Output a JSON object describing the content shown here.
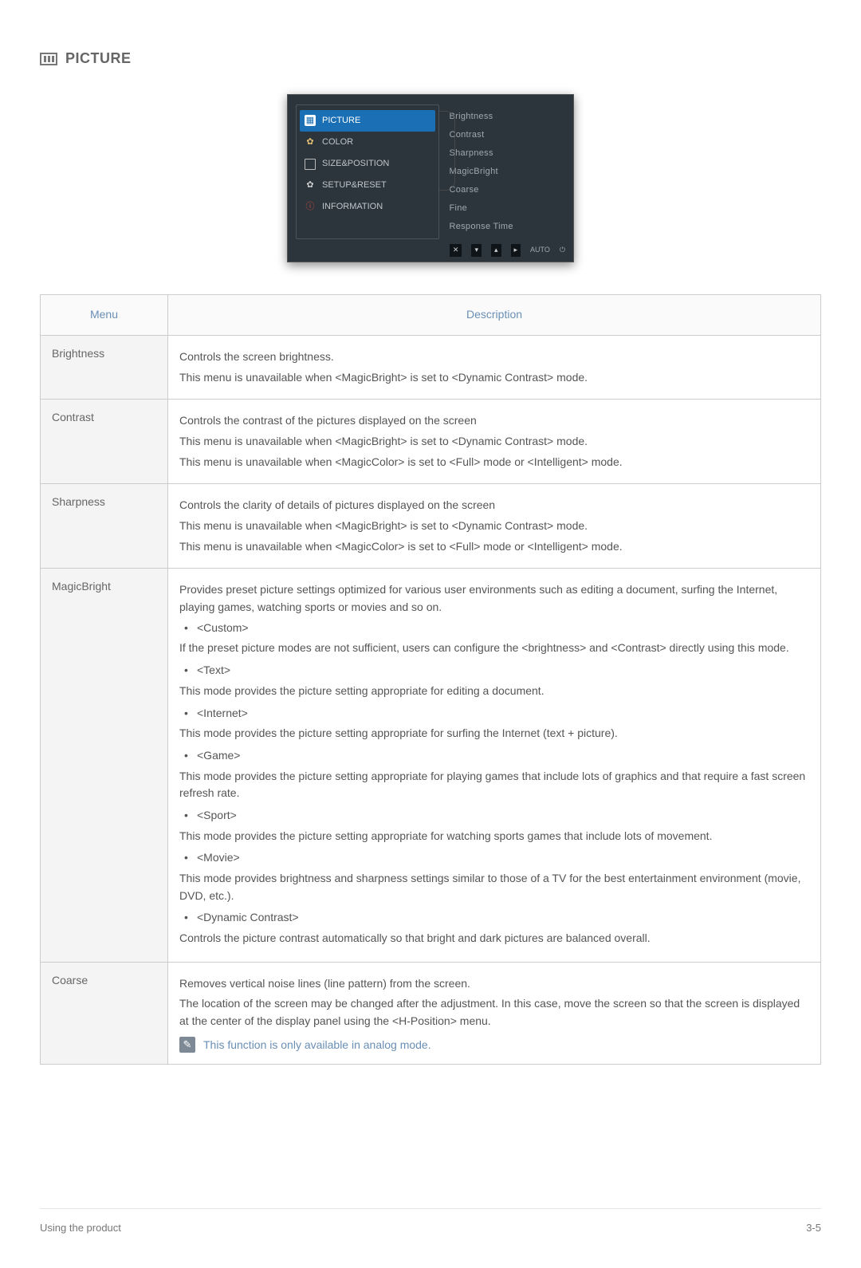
{
  "section_title": "PICTURE",
  "osd": {
    "left": [
      {
        "label": "PICTURE",
        "icon": "picture",
        "active": true
      },
      {
        "label": "COLOR",
        "icon": "color"
      },
      {
        "label": "SIZE&POSITION",
        "icon": "size"
      },
      {
        "label": "SETUP&RESET",
        "icon": "setup"
      },
      {
        "label": "INFORMATION",
        "icon": "info"
      }
    ],
    "right": [
      "Brightness",
      "Contrast",
      "Sharpness",
      "MagicBright",
      "Coarse",
      "Fine",
      "Response Time"
    ],
    "footer": [
      "✕",
      "▾",
      "▴",
      "▸",
      "AUTO",
      "⏻"
    ]
  },
  "table_headers": {
    "menu": "Menu",
    "description": "Description"
  },
  "rows": {
    "brightness": {
      "menu": "Brightness",
      "p1": "Controls the screen brightness.",
      "p2": "This menu is unavailable when <MagicBright> is set to <Dynamic Contrast> mode."
    },
    "contrast": {
      "menu": "Contrast",
      "p1": "Controls the contrast of the pictures displayed on the screen",
      "p2": "This menu is unavailable when <MagicBright> is set to <Dynamic Contrast> mode.",
      "p3": "This menu is unavailable when <MagicColor> is set to <Full> mode or <Intelligent> mode."
    },
    "sharpness": {
      "menu": "Sharpness",
      "p1": "Controls the clarity of details of pictures displayed on the screen",
      "p2": "This menu is unavailable when <MagicBright> is set to <Dynamic Contrast> mode.",
      "p3": "This menu is unavailable when <MagicColor> is set to <Full> mode or <Intelligent> mode."
    },
    "magicbright": {
      "menu": "MagicBright",
      "intro": "Provides preset picture settings optimized for various user environments such as editing a document, surfing the Internet, playing games, watching sports or movies and so on.",
      "opts": {
        "custom_b": "<Custom>",
        "custom_d": "If the preset picture modes are not sufficient, users can configure the <brightness> and <Contrast> directly using this mode.",
        "text_b": "<Text>",
        "text_d": "This mode provides the picture setting appropriate for editing a document.",
        "internet_b": "<Internet>",
        "internet_d": "This mode provides the picture setting appropriate for surfing the Internet (text + picture).",
        "game_b": "<Game>",
        "game_d": "This mode provides the picture setting appropriate for playing games that include lots of graphics and that require a fast screen refresh rate.",
        "sport_b": "<Sport>",
        "sport_d": "This mode provides the picture setting appropriate for watching sports games that include lots of movement.",
        "movie_b": "<Movie>",
        "movie_d": "This mode provides brightness and sharpness settings similar to those of a TV for the best entertainment environment (movie, DVD, etc.).",
        "dynamic_b": "<Dynamic Contrast>",
        "dynamic_d": "Controls the picture contrast automatically so that bright and dark pictures are balanced overall."
      }
    },
    "coarse": {
      "menu": "Coarse",
      "p1": "Removes vertical noise lines (line pattern) from the screen.",
      "p2": "The location of the screen may be changed after the adjustment. In this case, move the screen so that the screen is displayed at the center of the display panel using the <H-Position> menu.",
      "note": "This function is only available in analog mode."
    }
  },
  "footer_left": "Using the product",
  "footer_right": "3-5"
}
